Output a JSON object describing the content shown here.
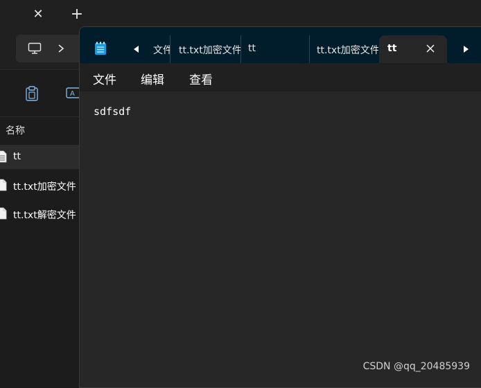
{
  "explorer": {
    "column_header": "名称",
    "files": [
      {
        "name": "tt",
        "selected": true
      },
      {
        "name": "tt.txt加密文件",
        "selected": false
      },
      {
        "name": "tt.txt解密文件",
        "selected": false
      }
    ]
  },
  "notepad": {
    "tabs": [
      {
        "label": "文件"
      },
      {
        "label": "tt.txt加密文件"
      },
      {
        "label": "tt"
      },
      {
        "label": "tt.txt加密文件"
      },
      {
        "label": "tt",
        "active": true
      }
    ],
    "menu": {
      "file": "文件",
      "edit": "编辑",
      "view": "查看"
    },
    "content": "sdfsdf"
  },
  "watermark": "CSDN @qq_20485939",
  "colors": {
    "tabbar": "#011c2a",
    "editor": "#272727",
    "menubar": "#202020",
    "app_icon": "#1e9ae0"
  }
}
